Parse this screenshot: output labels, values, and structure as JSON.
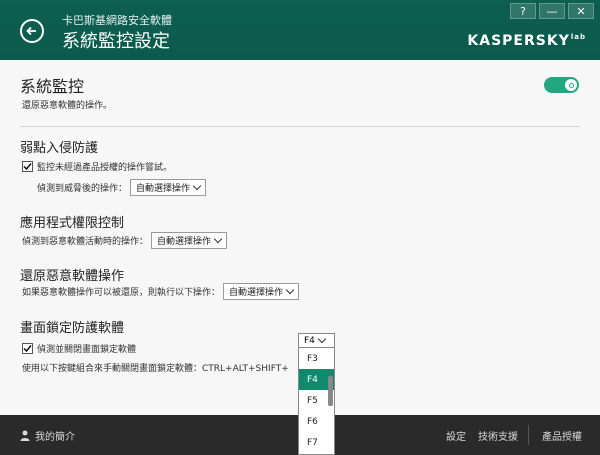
{
  "header": {
    "app_name": "卡巴斯基網路安全軟體",
    "page_title": "系統監控設定",
    "logo_text": "KASPERSKY",
    "logo_suffix": "lab",
    "help_label": "?",
    "minimize_label": "—",
    "close_label": "✕"
  },
  "main": {
    "title": "系統監控",
    "description": "還原惡意軟體的操作。",
    "toggle_on": true,
    "sections": {
      "exploit": {
        "title": "弱點入侵防護",
        "checkbox_label": "監控未經過產品授權的操作嘗試。",
        "checkbox_checked": true,
        "action_label": "偵測到威脅後的操作：",
        "action_value": "自動選擇操作"
      },
      "app_control": {
        "title": "應用程式權限控制",
        "action_label": "偵測到惡意軟體活動時的操作：",
        "action_value": "自動選擇操作"
      },
      "rollback": {
        "title": "還原惡意軟體操作",
        "action_label": "如果惡意軟體操作可以被還原，則執行以下操作：",
        "action_value": "自動選擇操作"
      },
      "screen_lock": {
        "title": "畫面鎖定防護軟體",
        "checkbox_label": "偵測並關閉畫面鎖定軟體",
        "checkbox_checked": true,
        "shortcut_label": "使用以下按鍵組合來手動關閉畫面鎖定軟體：CTRL+ALT+SHIFT+",
        "shortcut_value": "F4",
        "options": [
          "F3",
          "F4",
          "F5",
          "F6",
          "F7"
        ],
        "selected": "F4"
      }
    }
  },
  "footer": {
    "profile": "我的簡介",
    "settings": "設定",
    "support": "技術支援",
    "license": "產品授權"
  }
}
